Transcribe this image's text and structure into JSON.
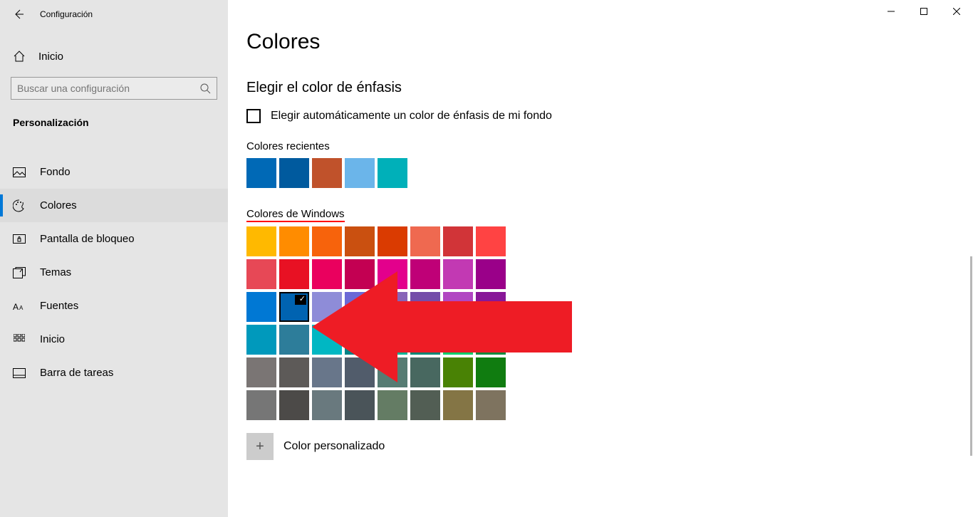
{
  "window": {
    "title": "Configuración"
  },
  "sidebar": {
    "home": "Inicio",
    "search_placeholder": "Buscar una configuración",
    "category": "Personalización",
    "items": [
      {
        "label": "Fondo"
      },
      {
        "label": "Colores"
      },
      {
        "label": "Pantalla de bloqueo"
      },
      {
        "label": "Temas"
      },
      {
        "label": "Fuentes"
      },
      {
        "label": "Inicio"
      },
      {
        "label": "Barra de tareas"
      }
    ]
  },
  "main": {
    "title": "Colores",
    "section": "Elegir el color de énfasis",
    "checkbox_label": "Elegir automáticamente un color de énfasis de mi fondo",
    "recent_head": "Colores recientes",
    "recent": [
      "#0069b6",
      "#005a9e",
      "#c0522b",
      "#6bb5ea",
      "#00b0b9"
    ],
    "win_head": "Colores de Windows",
    "rows": [
      [
        "#ffb900",
        "#ff8c00",
        "#f7630c",
        "#ca5010",
        "#da3b01",
        "#ef6950",
        "#d13438",
        "#ff4343"
      ],
      [
        "#e74856",
        "#e81123",
        "#ea005e",
        "#c30052",
        "#e3008c",
        "#bf0077",
        "#c239b3",
        "#9a0089"
      ],
      [
        "#0078d4",
        "#0063b1",
        "#8e8cd8",
        "#6b69d6",
        "#8764b8",
        "#744da9",
        "#b146c2",
        "#881798"
      ],
      [
        "#0099bc",
        "#2d7d9a",
        "#00b7c3",
        "#038387",
        "#00b294",
        "#018574",
        "#00cc6a",
        "#10893e"
      ],
      [
        "#7a7574",
        "#5d5a58",
        "#68768a",
        "#515c6b",
        "#567c73",
        "#486860",
        "#498205",
        "#107c10"
      ],
      [
        "#767676",
        "#4c4a48",
        "#69797e",
        "#4a5459",
        "#647c64",
        "#525e54",
        "#847545",
        "#7e735f"
      ]
    ],
    "selected_row": 2,
    "selected_col": 1,
    "custom": "Color personalizado"
  }
}
